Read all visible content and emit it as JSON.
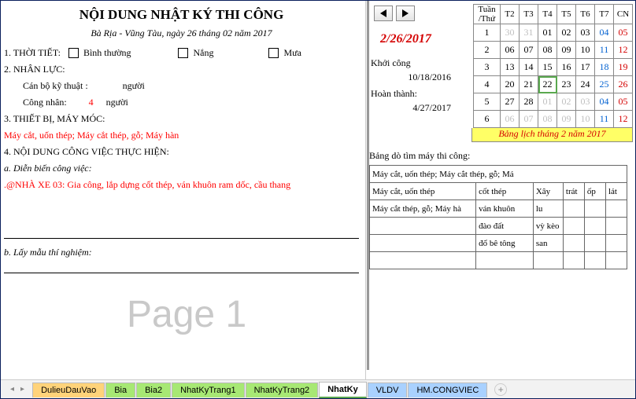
{
  "left": {
    "title": "NỘI DUNG NHẬT KÝ THI CÔNG",
    "subtitle": "Bà Rịa - Vũng Tàu, ngày 26 tháng 02 năm 2017",
    "sec1_label": "1. THỜI TIẾT:",
    "weather": {
      "opt1": "Bình thường",
      "opt2": "Nắng",
      "opt3": "Mưa"
    },
    "sec2_label": "2. NHÂN LỰC:",
    "staff1_label": "Cán bộ kỹ thuật :",
    "staff1_unit": "người",
    "staff2_label": "Công nhân:",
    "staff2_value": "4",
    "staff2_unit": "người",
    "sec3_label": "3. THIẾT BỊ, MÁY MÓC:",
    "equip_text": "Máy cắt, uốn thép; Máy cắt thép, gỗ; Máy hàn",
    "sec4_label": "4. NỘI DUNG CÔNG VIỆC THỰC HIỆN:",
    "sec4a_label": "a. Diễn biến công việc:",
    "work_text": ".@NHÀ XE 03: Gia công, lắp dựng cốt thép, ván khuôn ram dốc, cầu thang",
    "sec4b_label": "b. Lấy mẫu thí nghiệm:",
    "watermark": "Page 1"
  },
  "right": {
    "selected_date": "2/26/2017",
    "start_label": "Khởi công",
    "start_date": "10/18/2016",
    "end_label": "Hoàn thành:",
    "end_date": "4/27/2017",
    "cal": {
      "headers": [
        "Tuần /Thứ",
        "T2",
        "T3",
        "T4",
        "T5",
        "T6",
        "T7",
        "CN"
      ],
      "rows": [
        {
          "wk": "1",
          "cells": [
            {
              "v": "30",
              "c": "grey"
            },
            {
              "v": "31",
              "c": "grey"
            },
            {
              "v": "01"
            },
            {
              "v": "02"
            },
            {
              "v": "03"
            },
            {
              "v": "04",
              "c": "sat"
            },
            {
              "v": "05",
              "c": "sun"
            }
          ]
        },
        {
          "wk": "2",
          "cells": [
            {
              "v": "06"
            },
            {
              "v": "07"
            },
            {
              "v": "08"
            },
            {
              "v": "09"
            },
            {
              "v": "10"
            },
            {
              "v": "11",
              "c": "sat"
            },
            {
              "v": "12",
              "c": "sun"
            }
          ]
        },
        {
          "wk": "3",
          "cells": [
            {
              "v": "13"
            },
            {
              "v": "14"
            },
            {
              "v": "15"
            },
            {
              "v": "16"
            },
            {
              "v": "17"
            },
            {
              "v": "18",
              "c": "sat"
            },
            {
              "v": "19",
              "c": "sun"
            }
          ]
        },
        {
          "wk": "4",
          "cells": [
            {
              "v": "20"
            },
            {
              "v": "21"
            },
            {
              "v": "22",
              "sel": true
            },
            {
              "v": "23"
            },
            {
              "v": "24"
            },
            {
              "v": "25",
              "c": "sat"
            },
            {
              "v": "26",
              "c": "sun"
            }
          ]
        },
        {
          "wk": "5",
          "cells": [
            {
              "v": "27"
            },
            {
              "v": "28"
            },
            {
              "v": "01",
              "c": "grey"
            },
            {
              "v": "02",
              "c": "grey"
            },
            {
              "v": "03",
              "c": "grey"
            },
            {
              "v": "04",
              "c": "grey sat"
            },
            {
              "v": "05",
              "c": "grey sun"
            }
          ]
        },
        {
          "wk": "6",
          "cells": [
            {
              "v": "06",
              "c": "grey"
            },
            {
              "v": "07",
              "c": "grey"
            },
            {
              "v": "08",
              "c": "grey"
            },
            {
              "v": "09",
              "c": "grey"
            },
            {
              "v": "10",
              "c": "grey"
            },
            {
              "v": "11",
              "c": "grey sat"
            },
            {
              "v": "12",
              "c": "grey sun"
            }
          ]
        }
      ],
      "caption": "Bảng lịch tháng 2 năm 2017"
    },
    "lookup_title": "Bảng dò tìm máy thi công:",
    "lookup": [
      [
        "Máy cắt, uốn thép; Máy cắt thép, gỗ; Má",
        "",
        "",
        "",
        "",
        ""
      ],
      [
        "Máy cắt, uốn thép",
        "cốt thép",
        "Xây",
        "trát",
        "ốp",
        "lát"
      ],
      [
        "Máy cắt thép, gỗ; Máy hà",
        "ván khuôn",
        "lu",
        "",
        "",
        ""
      ],
      [
        "",
        "đào đất",
        "vỳ kèo",
        "",
        "",
        ""
      ],
      [
        "",
        "đổ bê tông",
        "san",
        "",
        "",
        ""
      ],
      [
        "",
        "",
        "",
        "",
        "",
        ""
      ]
    ]
  },
  "tabs": {
    "t1": "DulieuDauVao",
    "t2": "Bia",
    "t3": "Bia2",
    "t4": "NhatKyTrang1",
    "t5": "NhatKyTrang2",
    "t6": "NhatKy",
    "t7": "VLDV",
    "t8": "HM.CONGVIEC"
  }
}
